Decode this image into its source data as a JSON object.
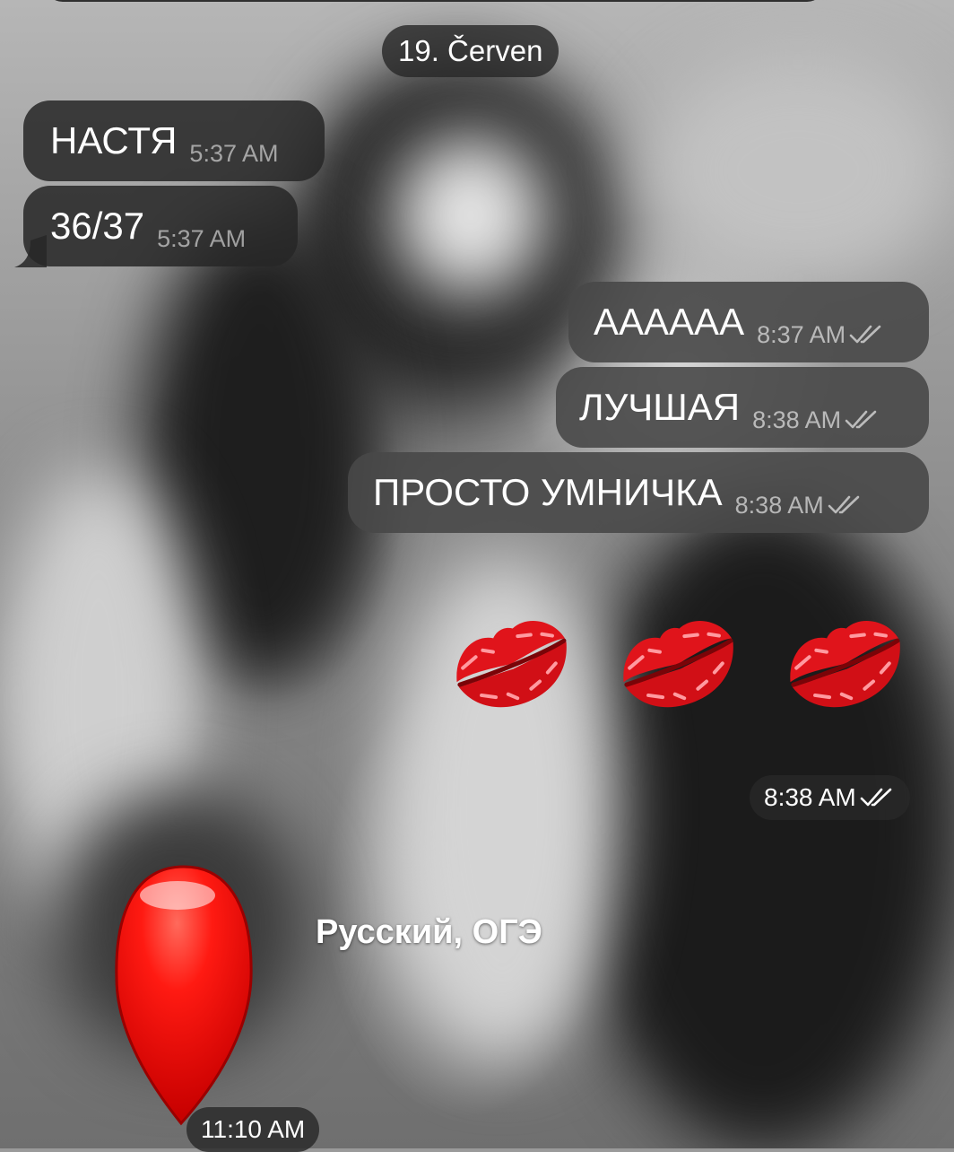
{
  "chat": {
    "date_separator": "19. Červen",
    "messages": [
      {
        "text": "НАСТЯ",
        "time": "5:37 AM",
        "direction": "incoming"
      },
      {
        "text": "36/37",
        "time": "5:37 AM",
        "direction": "incoming"
      },
      {
        "text": "АААААА",
        "time": "8:37 AM",
        "direction": "outgoing",
        "status": "read"
      },
      {
        "text": "ЛУЧШАЯ",
        "time": "8:38 AM",
        "direction": "outgoing",
        "status": "read"
      },
      {
        "text": "ПРОСТО УМНИЧКА",
        "time": "8:38 AM",
        "direction": "outgoing",
        "status": "read"
      }
    ],
    "emoji_message": {
      "emoji": [
        "kiss-mark-icon",
        "kiss-mark-icon",
        "kiss-mark-icon"
      ],
      "time": "8:38 AM",
      "status": "read"
    },
    "sticker_message": {
      "sticker": "red-balloon-icon",
      "caption": "Русский, ОГЭ",
      "time": "11:10 AM"
    }
  },
  "colors": {
    "incoming_bubble": "#262626",
    "outgoing_bubble": "#484848",
    "lips": "#e0141b",
    "balloon": "#ff1a12"
  }
}
